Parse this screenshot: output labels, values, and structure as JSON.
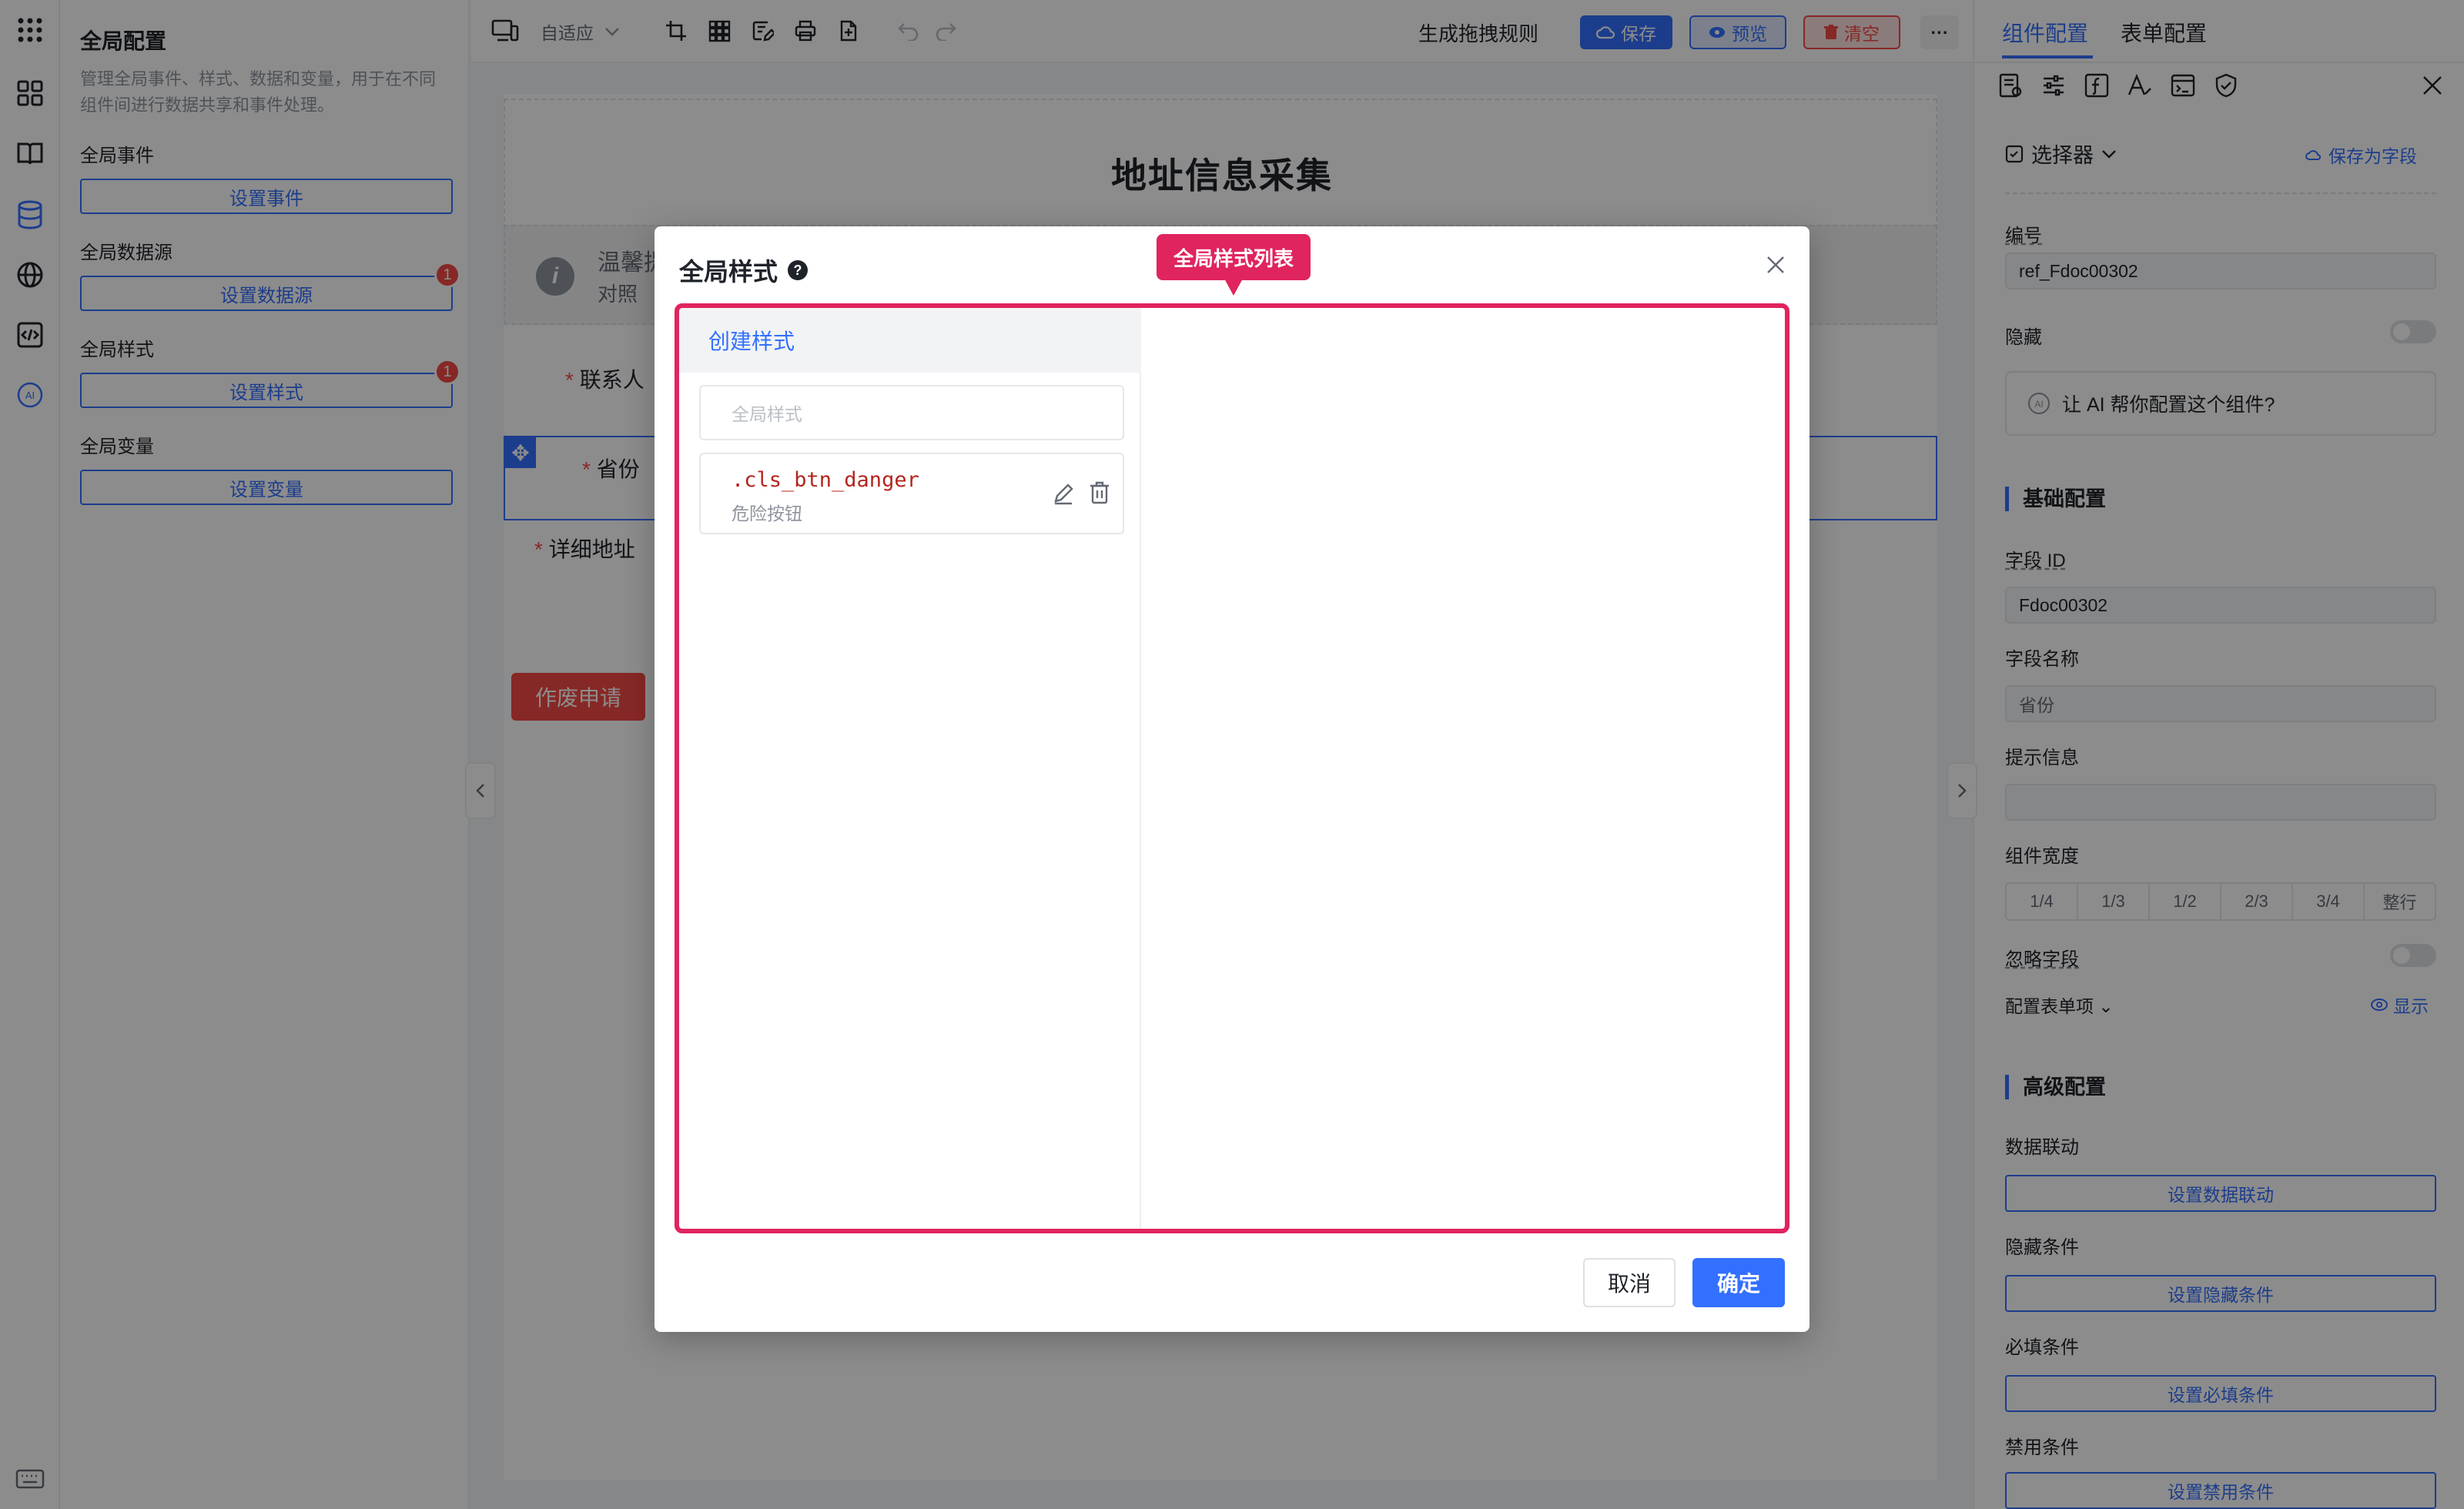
{
  "global_panel": {
    "title": "全局配置",
    "description": "管理全局事件、样式、数据和变量，用于在不同组件间进行数据共享和事件处理。",
    "sections": [
      {
        "title": "全局事件",
        "button": "设置事件",
        "badge": ""
      },
      {
        "title": "全局数据源",
        "button": "设置数据源",
        "badge": "1"
      },
      {
        "title": "全局样式",
        "button": "设置样式",
        "badge": "1"
      },
      {
        "title": "全局变量",
        "button": "设置变量",
        "badge": ""
      }
    ]
  },
  "toolbar": {
    "adapt_label": "自适应",
    "generate_rule": "生成拖拽规则",
    "save": "保存",
    "preview": "预览",
    "clear": "清空",
    "more": "···"
  },
  "form": {
    "title": "地址信息采集",
    "alert_title": "温馨提示",
    "alert_text": "对照",
    "fields": [
      "联系人",
      "省份",
      "详细地址"
    ],
    "void_button": "作废申请"
  },
  "right_panel": {
    "tabs": [
      "组件配置",
      "表单配置"
    ],
    "selector": "选择器",
    "save_as_field": "保存为字段",
    "number_label": "编号",
    "number_value": "ref_Fdoc00302",
    "hidden_label": "隐藏",
    "ai_prompt": "让 AI 帮你配置这个组件?",
    "basic_title": "基础配置",
    "field_id_label": "字段 ID",
    "field_id_value": "Fdoc00302",
    "field_name_label": "字段名称",
    "field_name_value": "省份",
    "hint_label": "提示信息",
    "hint_value": "",
    "width_label": "组件宽度",
    "widths": [
      "1/4",
      "1/3",
      "1/2",
      "2/3",
      "3/4",
      "整行"
    ],
    "ignore_label": "忽略字段",
    "form_item_label": "配置表单项",
    "show_label": "显示",
    "advanced_title": "高级配置",
    "advanced": [
      {
        "label": "数据联动",
        "button": "设置数据联动"
      },
      {
        "label": "隐藏条件",
        "button": "设置隐藏条件"
      },
      {
        "label": "必填条件",
        "button": "设置必填条件"
      },
      {
        "label": "禁用条件",
        "button": "设置禁用条件"
      }
    ]
  },
  "modal": {
    "title": "全局样式",
    "tooltip": "全局样式列表",
    "create_label": "创建样式",
    "search_placeholder": "全局样式",
    "items": [
      {
        "name": ".cls_btn_danger",
        "desc": "危险按钮"
      }
    ],
    "cancel": "取消",
    "confirm": "确定"
  },
  "colors": {
    "primary": "#3370ff",
    "danger": "#f54a45",
    "highlight": "#e0245e"
  }
}
